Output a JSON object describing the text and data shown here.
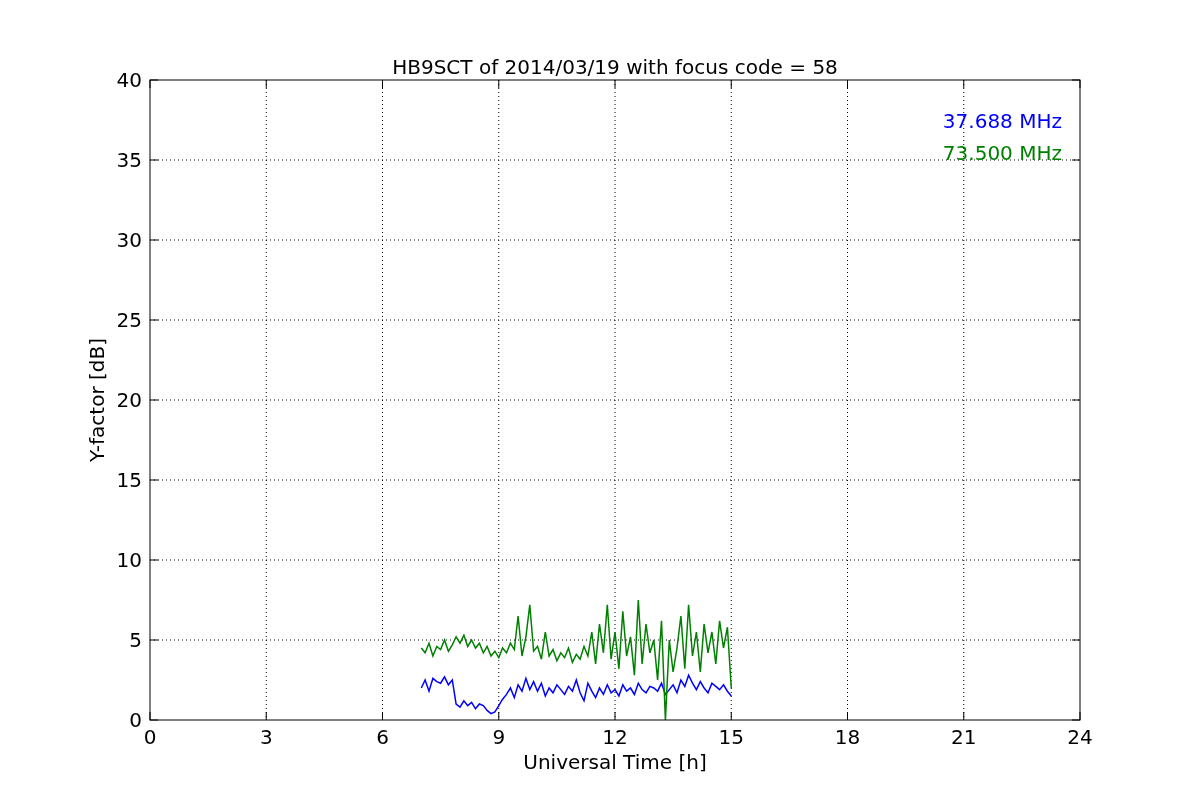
{
  "chart_data": {
    "type": "line",
    "title": "HB9SCT of 2014/03/19 with focus code = 58",
    "xlabel": "Universal Time [h]",
    "ylabel": "Y-factor [dB]",
    "x": [
      7.0,
      7.1,
      7.2,
      7.3,
      7.4,
      7.5,
      7.6,
      7.7,
      7.8,
      7.9,
      8.0,
      8.1,
      8.2,
      8.3,
      8.4,
      8.5,
      8.6,
      8.7,
      8.8,
      8.9,
      9.0,
      9.1,
      9.2,
      9.3,
      9.4,
      9.5,
      9.6,
      9.7,
      9.8,
      9.9,
      10.0,
      10.1,
      10.2,
      10.3,
      10.4,
      10.5,
      10.6,
      10.7,
      10.8,
      10.9,
      11.0,
      11.1,
      11.2,
      11.3,
      11.4,
      11.5,
      11.6,
      11.7,
      11.8,
      11.9,
      12.0,
      12.1,
      12.2,
      12.3,
      12.4,
      12.5,
      12.6,
      12.7,
      12.8,
      12.9,
      13.0,
      13.1,
      13.2,
      13.3,
      13.4,
      13.5,
      13.6,
      13.7,
      13.8,
      13.9,
      14.0,
      14.1,
      14.2,
      14.3,
      14.4,
      14.5,
      14.6,
      14.7,
      14.8,
      14.9,
      15.0
    ],
    "series": [
      {
        "name": "37.688 MHz",
        "color": "#0000ff",
        "values": [
          2.0,
          2.5,
          1.8,
          2.6,
          2.4,
          2.3,
          2.7,
          2.2,
          2.5,
          1.0,
          0.8,
          1.2,
          0.9,
          1.1,
          0.7,
          1.0,
          0.9,
          0.6,
          0.4,
          0.5,
          0.9,
          1.3,
          1.6,
          2.0,
          1.4,
          2.2,
          1.8,
          2.6,
          1.9,
          2.4,
          1.8,
          2.3,
          1.5,
          2.0,
          1.7,
          2.2,
          1.9,
          1.6,
          2.1,
          1.8,
          2.5,
          1.7,
          1.2,
          2.3,
          1.8,
          1.4,
          2.0,
          1.6,
          2.2,
          1.7,
          1.9,
          1.5,
          2.2,
          1.8,
          2.0,
          1.6,
          2.3,
          1.9,
          1.7,
          2.1,
          2.0,
          1.8,
          2.3,
          1.6,
          1.9,
          2.2,
          1.7,
          2.5,
          2.1,
          2.8,
          2.3,
          1.9,
          2.4,
          2.0,
          1.7,
          2.3,
          2.1,
          1.9,
          2.2,
          1.8,
          1.5
        ]
      },
      {
        "name": "73.500 MHz",
        "color": "#008000",
        "values": [
          4.5,
          4.2,
          4.8,
          4.0,
          4.6,
          4.4,
          5.0,
          4.3,
          4.7,
          5.2,
          4.8,
          5.3,
          4.6,
          5.0,
          4.5,
          4.8,
          4.2,
          4.6,
          4.0,
          4.3,
          3.9,
          4.5,
          4.2,
          4.8,
          4.4,
          6.5,
          4.0,
          5.2,
          7.2,
          4.3,
          4.6,
          3.8,
          5.5,
          4.0,
          4.4,
          3.7,
          4.2,
          3.9,
          4.5,
          3.6,
          4.1,
          3.8,
          4.6,
          4.0,
          5.5,
          3.5,
          6.0,
          4.2,
          7.2,
          3.8,
          5.5,
          3.2,
          6.8,
          4.0,
          5.2,
          2.8,
          7.5,
          3.5,
          6.0,
          4.2,
          5.0,
          2.5,
          6.2,
          0.0,
          5.0,
          3.0,
          4.5,
          6.5,
          3.2,
          7.2,
          4.0,
          5.5,
          3.0,
          6.0,
          4.2,
          5.5,
          3.5,
          6.2,
          4.5,
          5.8,
          2.0
        ]
      }
    ],
    "grid": true,
    "xlim": [
      0,
      24
    ],
    "ylim": [
      0,
      40
    ],
    "xticks": [
      0,
      3,
      6,
      9,
      12,
      15,
      18,
      21,
      24
    ],
    "yticks": [
      0,
      5,
      10,
      15,
      20,
      25,
      30,
      35,
      40
    ]
  }
}
